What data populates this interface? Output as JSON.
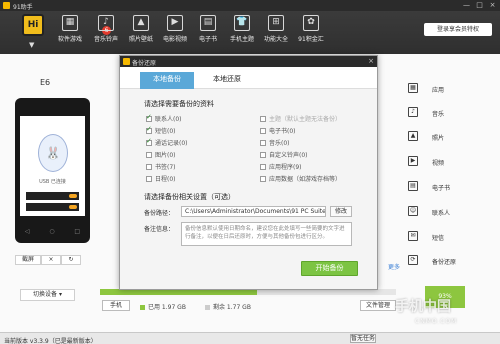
{
  "app": {
    "title": "91助手",
    "window_controls": [
      "—",
      "□",
      "×"
    ]
  },
  "toolbar": {
    "hi_label": "Hi",
    "items": [
      {
        "label": "软件游戏",
        "icon": "apps-icon"
      },
      {
        "label": "音乐铃声",
        "icon": "music-icon"
      },
      {
        "label": "照片壁纸",
        "icon": "image-icon"
      },
      {
        "label": "电影视频",
        "icon": "video-icon"
      },
      {
        "label": "电子书",
        "icon": "book-icon"
      },
      {
        "label": "手机主题",
        "icon": "shirt-icon"
      },
      {
        "label": "功能大全",
        "icon": "grid-icon"
      },
      {
        "label": "91积金汇",
        "icon": "gift-icon"
      }
    ],
    "badge": "6",
    "login_label": "登录享会员特权"
  },
  "device": {
    "name": "E6",
    "usb_text": "USB 已连接",
    "actions": {
      "screenshot": "截屏",
      "close": "×",
      "refresh": "↻"
    },
    "switch_label": "切换设备"
  },
  "sidebar": {
    "items": [
      {
        "label": "应用",
        "icon": "apps-icon"
      },
      {
        "label": "音乐",
        "icon": "music-icon"
      },
      {
        "label": "照片",
        "icon": "image-icon"
      },
      {
        "label": "视频",
        "icon": "video-icon"
      },
      {
        "label": "电子书",
        "icon": "book-icon"
      },
      {
        "label": "联系人",
        "icon": "contacts-icon"
      },
      {
        "label": "短信",
        "icon": "sms-icon"
      },
      {
        "label": "备份还原",
        "icon": "backup-icon"
      }
    ],
    "more_label": "更多"
  },
  "storage": {
    "tag": "手机",
    "used_label": "已用 1.97 GB",
    "free_label": "剩余 1.77 GB",
    "file_btn": "文件管理",
    "percent": "93%",
    "used_fraction": 0.53,
    "used_color": "#8dc63f"
  },
  "status": {
    "version": "当前版本 v3.3.9（已是最新版本）",
    "pause_label": "暂无任务"
  },
  "watermark": {
    "text": "手机中国",
    "sub": "CNMO.COM"
  },
  "dialog": {
    "title": "备份还原",
    "tabs": [
      "本地备份",
      "本地还原"
    ],
    "section1_title": "请选择需要备份的资料",
    "left_options": [
      {
        "label": "联系人(0)",
        "checked": true
      },
      {
        "label": "短信(0)",
        "checked": true
      },
      {
        "label": "通话记录(0)",
        "checked": true
      },
      {
        "label": "图片(0)",
        "checked": false
      },
      {
        "label": "书签(7)",
        "checked": false
      },
      {
        "label": "日程(0)",
        "checked": false
      }
    ],
    "right_options": [
      {
        "label": "主题（默认主题无法备份）",
        "checked": false,
        "disabled": true
      },
      {
        "label": "电子书(0)",
        "checked": false
      },
      {
        "label": "音乐(0)",
        "checked": false
      },
      {
        "label": "自定义铃声(0)",
        "checked": false
      },
      {
        "label": "应用程序(9)",
        "checked": false
      },
      {
        "label": "应用数据（如游戏存档等）",
        "checked": false
      }
    ],
    "section2_title": "请选择备份相关设置（可选）",
    "path_label": "备份路径：",
    "path_value": "C:\\Users\\Administrator\\Documents\\91 PC Suite\\Ba",
    "modify_label": "修改",
    "note_label": "备注信息：",
    "note_placeholder": "备份信息默认使用日期命名，建议您在此处填写一些简要的文字进行备注，以便在日后还原时，方便与其他备份包进行区分。",
    "start_label": "开始备份"
  }
}
